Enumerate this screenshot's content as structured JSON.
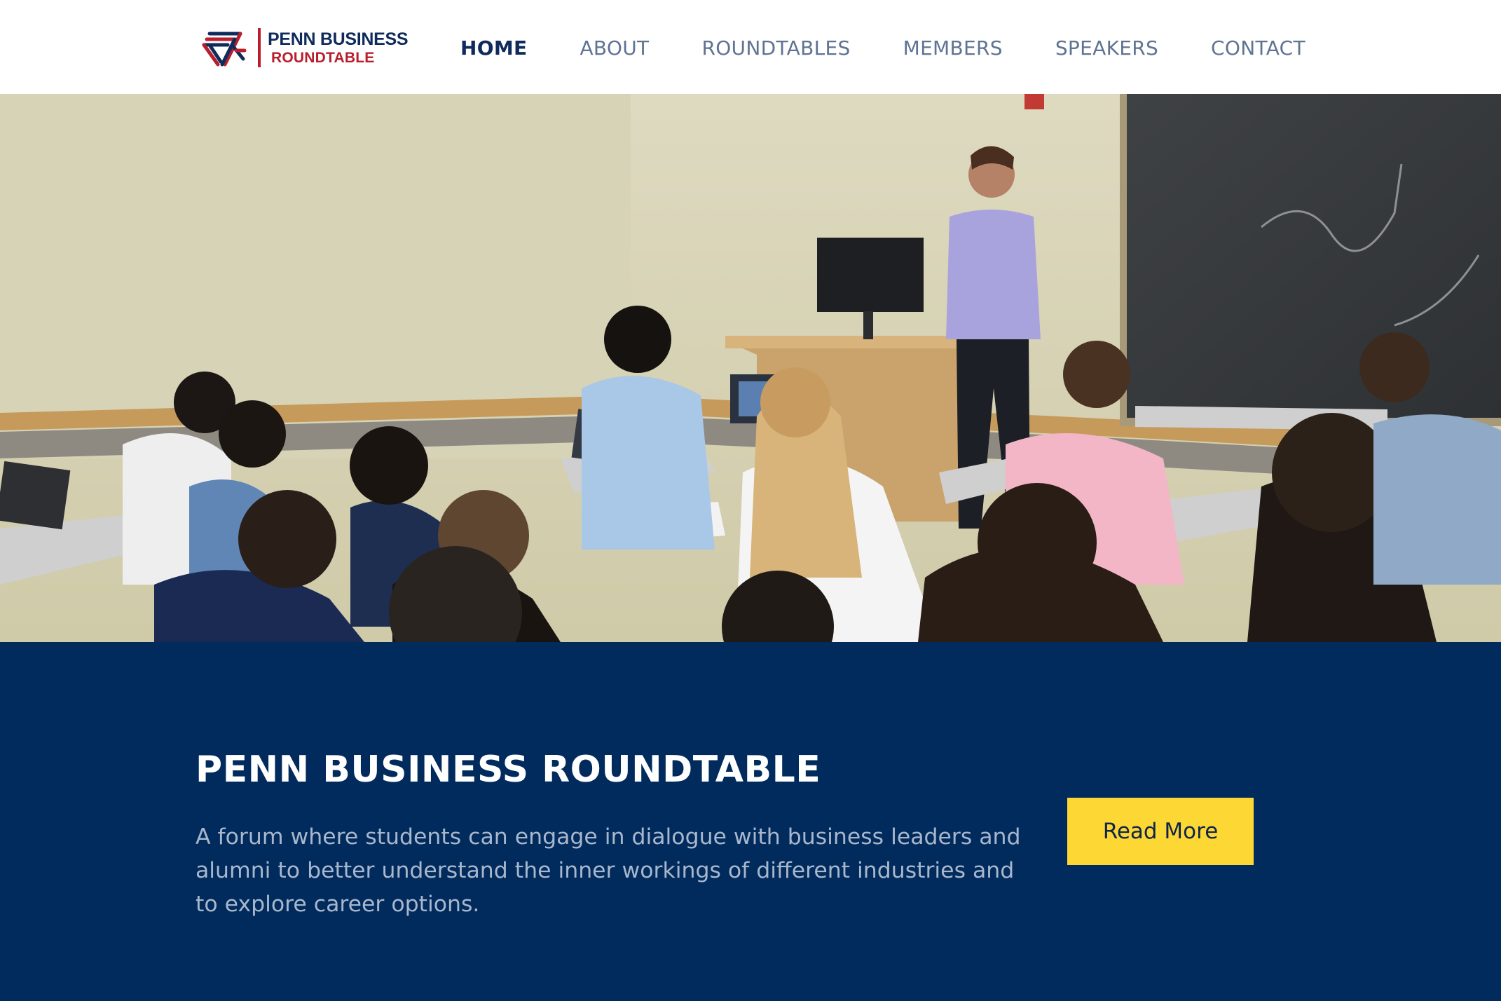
{
  "logo": {
    "line1": "PENN BUSINESS",
    "line2": "ROUNDTABLE",
    "colors": {
      "navy": "#0f2b5c",
      "red": "#b81e2c"
    }
  },
  "nav": {
    "items": [
      {
        "label": "HOME",
        "active": true
      },
      {
        "label": "ABOUT",
        "active": false
      },
      {
        "label": "ROUNDTABLES",
        "active": false
      },
      {
        "label": "MEMBERS",
        "active": false
      },
      {
        "label": "SPEAKERS",
        "active": false
      },
      {
        "label": "CONTACT",
        "active": false
      }
    ]
  },
  "hero": {
    "image": "classroom-lecture-photo"
  },
  "banner": {
    "title": "PENN BUSINESS ROUNDTABLE",
    "description": "A forum where students can engage in dialogue with business leaders and alumni to better understand the inner workings of different industries and to explore career options.",
    "button_label": "Read More",
    "colors": {
      "background": "#002b5c",
      "button": "#fdd835",
      "text_muted": "#a9b7cd"
    }
  }
}
